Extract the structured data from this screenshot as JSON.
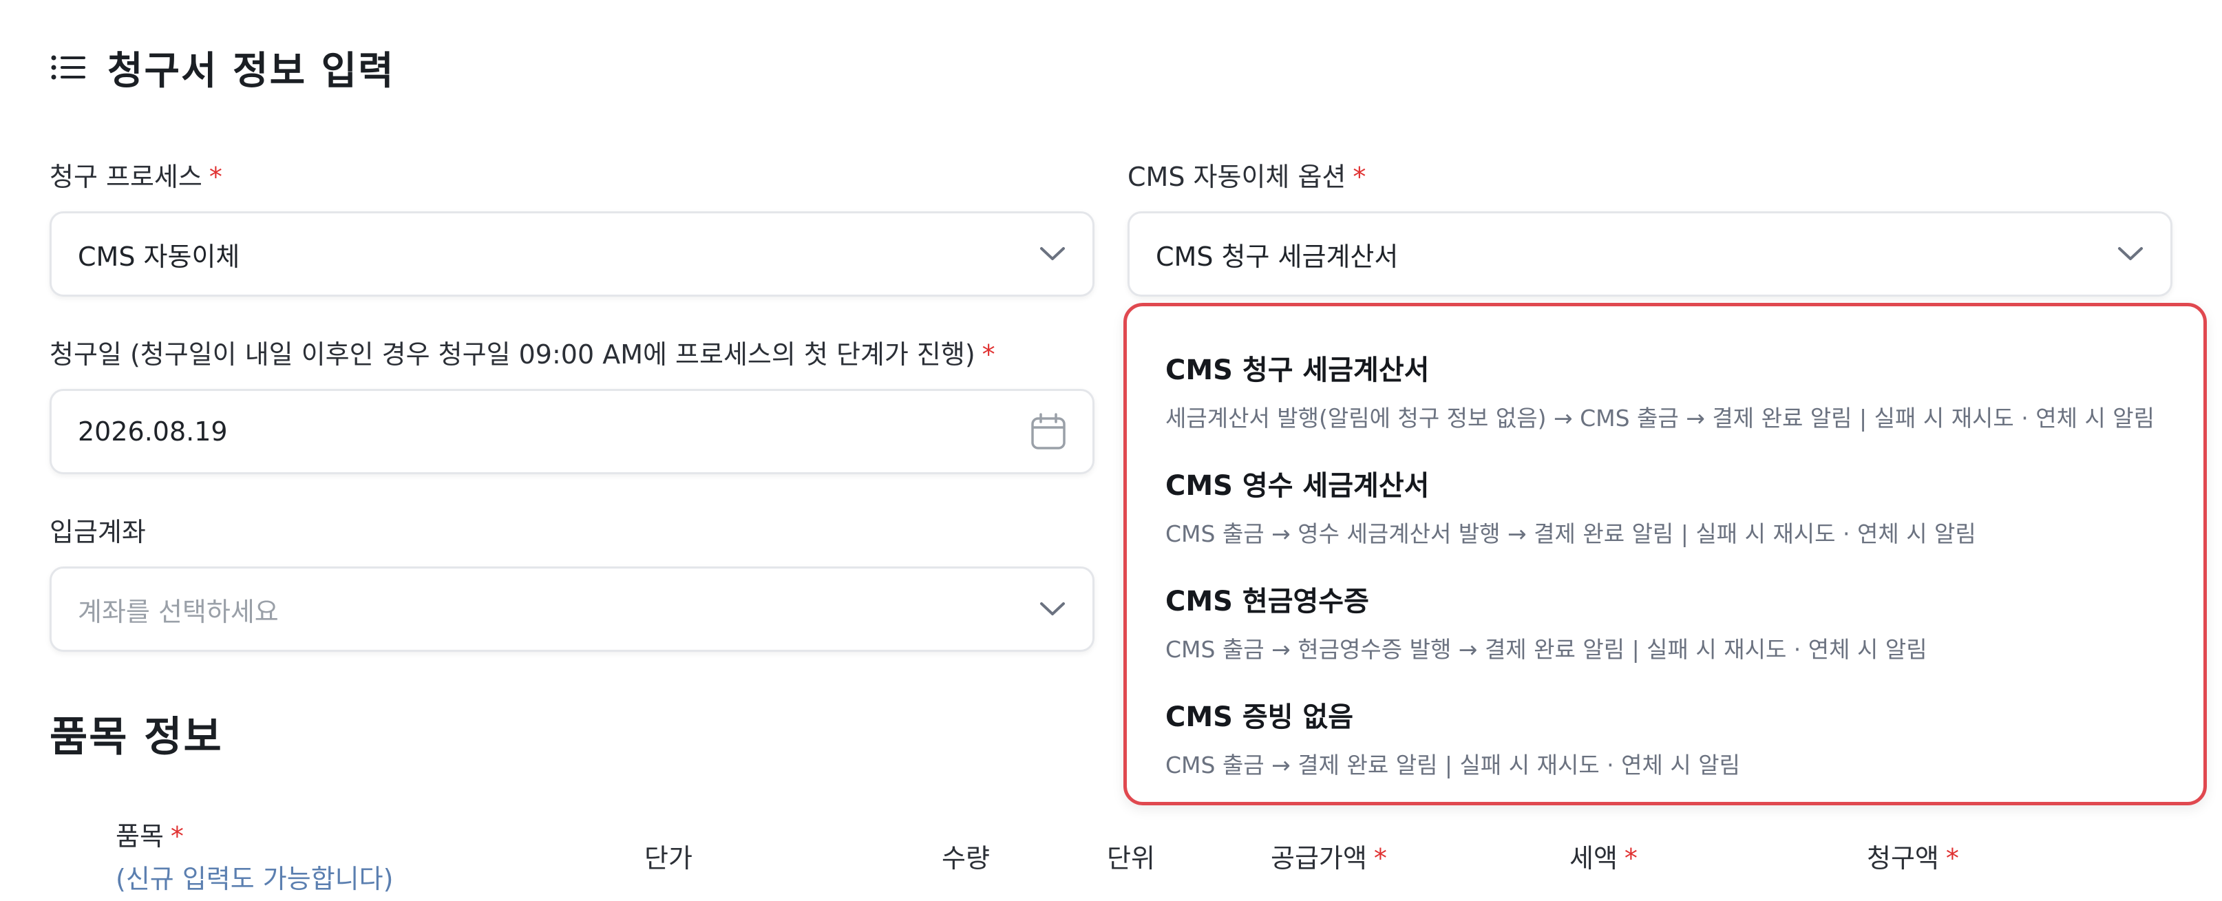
{
  "header": {
    "title": "청구서 정보 입력",
    "icon": "list-icon"
  },
  "billing_process": {
    "label": "청구 프로세스",
    "required": "*",
    "value": "CMS 자동이체"
  },
  "cms_option": {
    "label": "CMS 자동이체 옵션",
    "required": "*",
    "value": "CMS 청구 세금계산서"
  },
  "billing_date": {
    "label": "청구일 (청구일이 내일 이후인 경우 청구일 09:00 AM에 프로세스의 첫 단계가 진행)",
    "required": "*",
    "value": "2026.08.19"
  },
  "deposit_account": {
    "label": "입금계좌",
    "placeholder": "계좌를 선택하세요"
  },
  "dropdown": {
    "border_color": "#e0484f",
    "options": [
      {
        "name": "CMS 청구 세금계산서",
        "desc": "세금계산서 발행(알림에 청구 정보 없음) → CMS 출금 → 결제 완료 알림 | 실패 시 재시도 · 연체 시 알림"
      },
      {
        "name": "CMS 영수 세금계산서",
        "desc": "CMS 출금 → 영수 세금계산서 발행 → 결제 완료 알림 | 실패 시 재시도 · 연체 시 알림"
      },
      {
        "name": "CMS 현금영수증",
        "desc": "CMS 출금 → 현금영수증 발행 → 결제 완료 알림 | 실패 시 재시도 · 연체 시 알림"
      },
      {
        "name": "CMS 증빙 없음",
        "desc": "CMS 출금 → 결제 완료 알림 | 실패 시 재시도 · 연체 시 알림"
      }
    ]
  },
  "items_section": {
    "title": "품목 정보",
    "columns": {
      "item": "품목",
      "item_hint": "(신규 입력도 가능합니다)",
      "unit_price": "단가",
      "quantity": "수량",
      "unit": "단위",
      "supply_amount": "공급가액",
      "tax": "세액",
      "billed_amount": "청구액"
    },
    "required_mark": "*"
  }
}
